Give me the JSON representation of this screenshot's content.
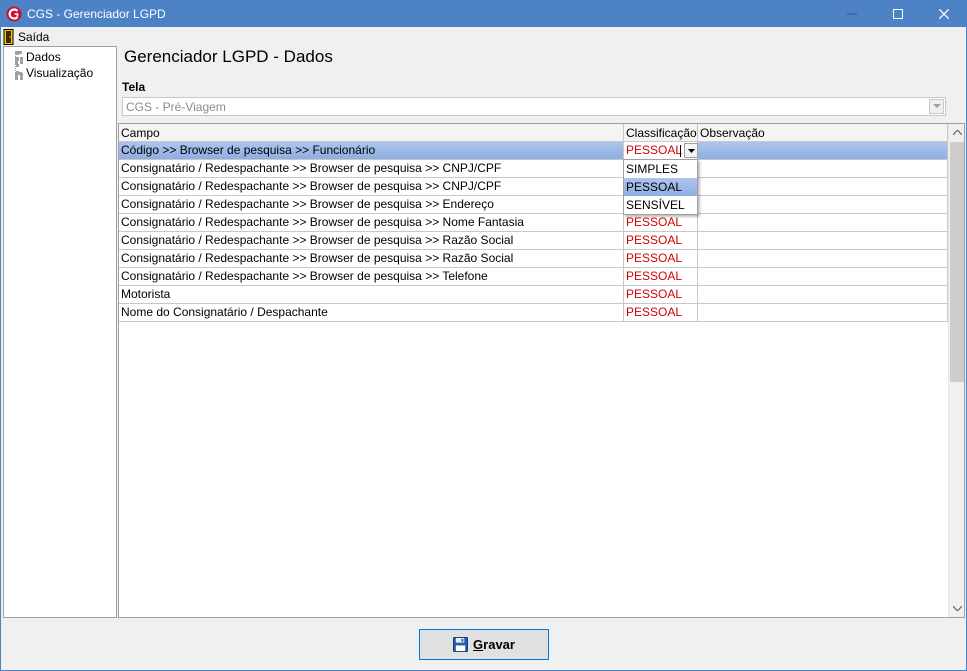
{
  "window": {
    "title": "CGS - Gerenciador LGPD"
  },
  "menu": {
    "exit_label": "Saída"
  },
  "tree": {
    "items": [
      "Dados",
      "Visualização"
    ]
  },
  "page": {
    "title": "Gerenciador LGPD - Dados",
    "tela_label": "Tela",
    "tela_value": "CGS - Pré-Viagem"
  },
  "grid": {
    "columns": [
      "Campo",
      "Classificação",
      "Observação"
    ],
    "rows": [
      {
        "campo": "Código >> Browser de pesquisa >> Funcionário",
        "classificacao": "PESSOAL",
        "observacao": ""
      },
      {
        "campo": "Consignatário / Redespachante >> Browser de pesquisa >> CNPJ/CPF",
        "classificacao": "",
        "observacao": ""
      },
      {
        "campo": "Consignatário / Redespachante >> Browser de pesquisa >> CNPJ/CPF",
        "classificacao": "",
        "observacao": ""
      },
      {
        "campo": "Consignatário / Redespachante >> Browser de pesquisa >> Endereço",
        "classificacao": "",
        "observacao": ""
      },
      {
        "campo": "Consignatário / Redespachante >> Browser de pesquisa >> Nome Fantasia",
        "classificacao": "PESSOAL",
        "observacao": ""
      },
      {
        "campo": "Consignatário / Redespachante >> Browser de pesquisa >> Razão Social",
        "classificacao": "PESSOAL",
        "observacao": ""
      },
      {
        "campo": "Consignatário / Redespachante >> Browser de pesquisa >> Razão Social",
        "classificacao": "PESSOAL",
        "observacao": ""
      },
      {
        "campo": "Consignatário / Redespachante >> Browser de pesquisa >> Telefone",
        "classificacao": "PESSOAL",
        "observacao": ""
      },
      {
        "campo": "Motorista",
        "classificacao": "PESSOAL",
        "observacao": ""
      },
      {
        "campo": "Nome do Consignatário / Despachante",
        "classificacao": "PESSOAL",
        "observacao": ""
      }
    ],
    "dropdown_options": [
      "SIMPLES",
      "PESSOAL",
      "SENSÍVEL"
    ],
    "dropdown_highlighted": "PESSOAL"
  },
  "actions": {
    "save_label_underlined": "G",
    "save_label_rest": "ravar"
  },
  "colors": {
    "titlebar": "#4d82c7",
    "selection": "#aec4ec",
    "classification_text": "#d40000"
  },
  "icons": {
    "app": "cgs-logo-icon",
    "exit": "exit-door-icon",
    "save": "floppy-disk-icon"
  }
}
